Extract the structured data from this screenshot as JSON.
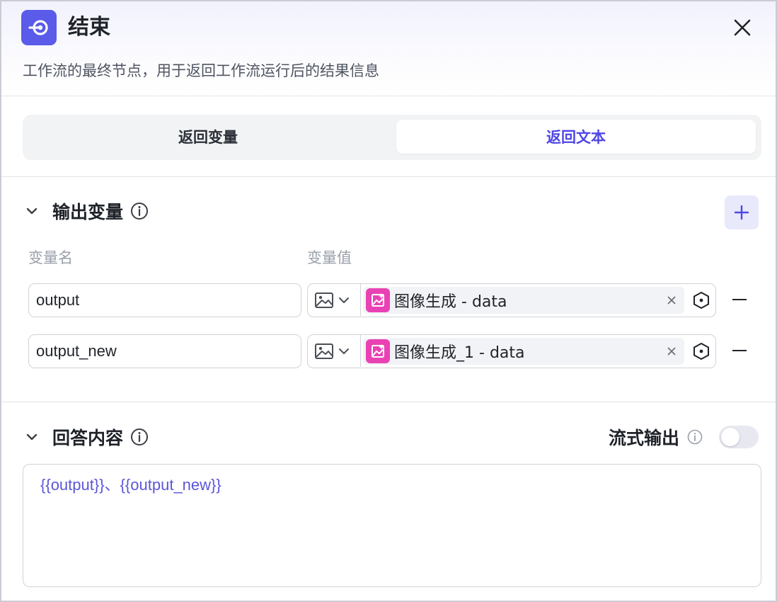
{
  "header": {
    "title": "结束",
    "subtitle": "工作流的最终节点，用于返回工作流运行后的结果信息",
    "icon": "end-node-icon",
    "accent_color": "#5a5be8"
  },
  "tabs": [
    {
      "label": "返回变量",
      "selected": false
    },
    {
      "label": "返回文本",
      "selected": true
    }
  ],
  "output_vars": {
    "title": "输出变量",
    "columns": {
      "name": "变量名",
      "value": "变量值"
    },
    "rows": [
      {
        "name": "output",
        "type_icon": "image-icon",
        "source": "图像生成",
        "separator": " - ",
        "field": "data"
      },
      {
        "name": "output_new",
        "type_icon": "image-icon",
        "source": "图像生成_1",
        "separator": " - ",
        "field": "data"
      }
    ]
  },
  "answer": {
    "title": "回答内容",
    "stream_label": "流式输出",
    "stream_enabled": false,
    "content": {
      "token1": "{{output}}",
      "separator": "、",
      "token2": "{{output_new}}"
    }
  },
  "colors": {
    "chip_icon": "#e942b4",
    "selected_tab_text": "#4f46e5",
    "token_text": "#5b57d9"
  }
}
